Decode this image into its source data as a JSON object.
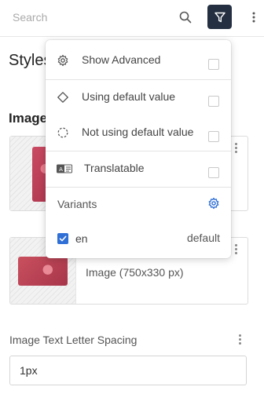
{
  "search": {
    "placeholder": "Search"
  },
  "section": {
    "title": "Styles"
  },
  "group": {
    "label": "Image"
  },
  "cards": [
    {
      "caption": ""
    },
    {
      "caption": "Image (750x330 px)"
    }
  ],
  "field": {
    "label": "Image Text Letter Spacing",
    "value": "1px"
  },
  "filter_menu": {
    "items": [
      {
        "label": "Show Advanced",
        "icon": "cog-outline-icon",
        "checked": false
      },
      {
        "label": "Using default value",
        "icon": "diamond-icon",
        "checked": false
      },
      {
        "label": "Not using default value",
        "icon": "dashed-circle-icon",
        "checked": false
      },
      {
        "label": "Translatable",
        "icon": "translate-icon",
        "checked": false
      }
    ],
    "variants_label": "Variants",
    "variant": {
      "label": "en",
      "default_label": "default",
      "checked": true
    }
  },
  "colors": {
    "accent": "#2f6fd6",
    "filter_button_bg": "#243041"
  }
}
